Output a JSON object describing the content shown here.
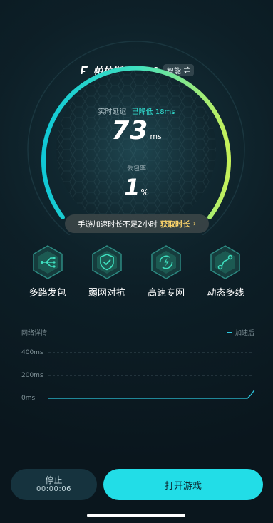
{
  "engine": {
    "title": "帕拉斯引擎2.0",
    "mode": "智能",
    "mode_icon": "swap-icon",
    "logo_icon": "flag-logo-icon"
  },
  "metrics": {
    "latency_label": "实时延迟",
    "latency_reduced": "已降低 18ms",
    "latency_value": "73",
    "latency_unit": "ms",
    "loss_label": "丢包率",
    "loss_value": "1",
    "loss_unit": "%"
  },
  "notice": {
    "text": "手游加速时长不足2小时",
    "cta": "获取时长",
    "chevron": "›"
  },
  "features": [
    {
      "label": "多路发包",
      "icon": "multipath-icon"
    },
    {
      "label": "弱网对抗",
      "icon": "shield-check-icon"
    },
    {
      "label": "高速专网",
      "icon": "lightning-cycle-icon"
    },
    {
      "label": "动态多线",
      "icon": "dynamic-route-icon"
    }
  ],
  "network_chart": {
    "title": "网络详情",
    "legend": "加速后",
    "colors": {
      "line": "#2ec9e0",
      "accent": "#22dde7"
    }
  },
  "chart_data": {
    "type": "line",
    "title": "网络详情",
    "y_ticks": [
      "400ms",
      "200ms",
      "0ms"
    ],
    "ylim": [
      0,
      400
    ],
    "series": [
      {
        "name": "加速后",
        "values": [
          0,
          0,
          0,
          0,
          0,
          0,
          0,
          0,
          0,
          0,
          0,
          0,
          0,
          0,
          0,
          0,
          0,
          0,
          0,
          0,
          0,
          0,
          0,
          0,
          0,
          0,
          0,
          0,
          0,
          0,
          0,
          0,
          0,
          0,
          0,
          0,
          0,
          0,
          0,
          0,
          0,
          0,
          0,
          0,
          0,
          0,
          0,
          0,
          0,
          0,
          0,
          0,
          0,
          0,
          0,
          0,
          0,
          0,
          30,
          73
        ]
      }
    ],
    "grid": true,
    "legend_position": "top-right"
  },
  "actions": {
    "stop_label": "停止",
    "timer": "00:00:06",
    "open_label": "打开游戏"
  }
}
